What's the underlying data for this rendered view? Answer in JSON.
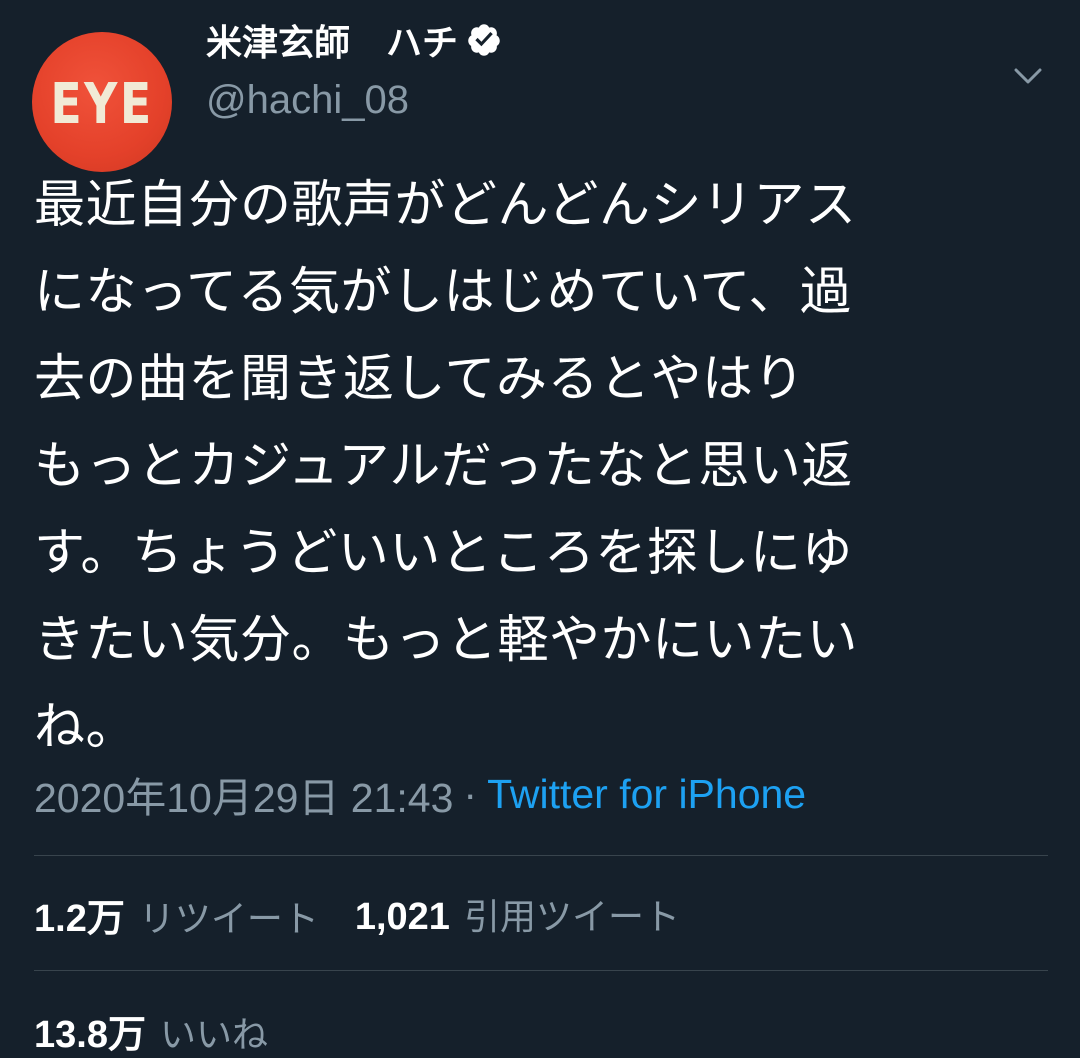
{
  "author": {
    "display_name": "米津玄師　ハチ",
    "handle": "@hachi_08",
    "avatar_text": "EYE",
    "verified": true
  },
  "icons": {
    "verified": "verified-badge-icon",
    "more": "chevron-down-icon"
  },
  "tweet": {
    "lines": [
      "最近自分の歌声がどんどんシリアス",
      "になってる気がしはじめていて、過",
      "去の曲を聞き返してみるとやはり",
      "もっとカジュアルだったなと思い返",
      "す。ちょうどいいところを探しにゆ",
      "きたい気分。もっと軽やかにいたい",
      "ね。"
    ],
    "timestamp": "2020年10月29日 21:43",
    "separator": "·",
    "source": "Twitter for iPhone"
  },
  "stats": {
    "retweets": {
      "value": "1.2万",
      "label": "リツイート"
    },
    "quotes": {
      "value": "1,021",
      "label": "引用ツイート"
    },
    "likes": {
      "value": "13.8万",
      "label": "いいね"
    }
  },
  "colors": {
    "background": "#15202b",
    "text_primary": "#ffffff",
    "text_secondary": "#8899a6",
    "link": "#1da1f2",
    "divider": "#38444d",
    "avatar_bg": "#e4412a"
  }
}
